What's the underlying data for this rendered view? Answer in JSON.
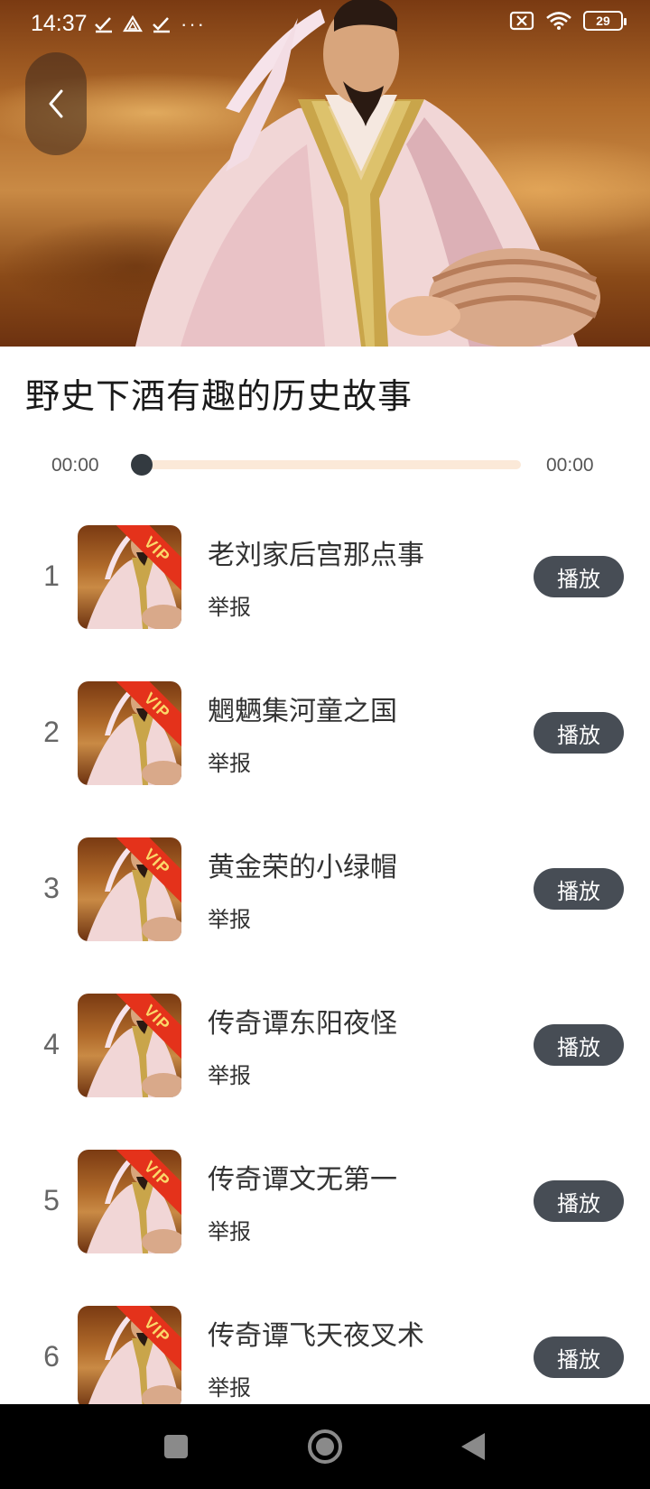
{
  "status_bar": {
    "time": "14:37",
    "left_icons": [
      "check-download-icon",
      "drive-icon",
      "check-download-icon",
      "more-dots-icon"
    ],
    "more_text": "···",
    "battery_level": "29",
    "right_icons": [
      "no-sim-icon",
      "wifi-icon",
      "battery-icon"
    ]
  },
  "header": {
    "back_icon": "chevron-left-icon"
  },
  "album": {
    "title": "野史下酒有趣的历史故事"
  },
  "player": {
    "current_time": "00:00",
    "total_time": "00:00",
    "progress": 0.0
  },
  "tracks": [
    {
      "index": "1",
      "title": "老刘家后宫那点事",
      "report_label": "举报",
      "play_label": "播放",
      "badge": "VIP"
    },
    {
      "index": "2",
      "title": "魍魉集河童之国",
      "report_label": "举报",
      "play_label": "播放",
      "badge": "VIP"
    },
    {
      "index": "3",
      "title": "黄金荣的小绿帽",
      "report_label": "举报",
      "play_label": "播放",
      "badge": "VIP"
    },
    {
      "index": "4",
      "title": "传奇谭东阳夜怪",
      "report_label": "举报",
      "play_label": "播放",
      "badge": "VIP"
    },
    {
      "index": "5",
      "title": "传奇谭文无第一",
      "report_label": "举报",
      "play_label": "播放",
      "badge": "VIP"
    },
    {
      "index": "6",
      "title": "传奇谭飞天夜叉术",
      "report_label": "举报",
      "play_label": "播放",
      "badge": "VIP"
    }
  ],
  "nav_bar": {
    "buttons": [
      "recents-square-icon",
      "home-circle-icon",
      "back-triangle-icon"
    ]
  },
  "colors": {
    "play_button_bg": "#474d55",
    "progress_track": "#fbe9d8",
    "progress_thumb": "#333a40",
    "vip_ribbon": "#e4321b",
    "vip_text": "#fbd86a"
  }
}
